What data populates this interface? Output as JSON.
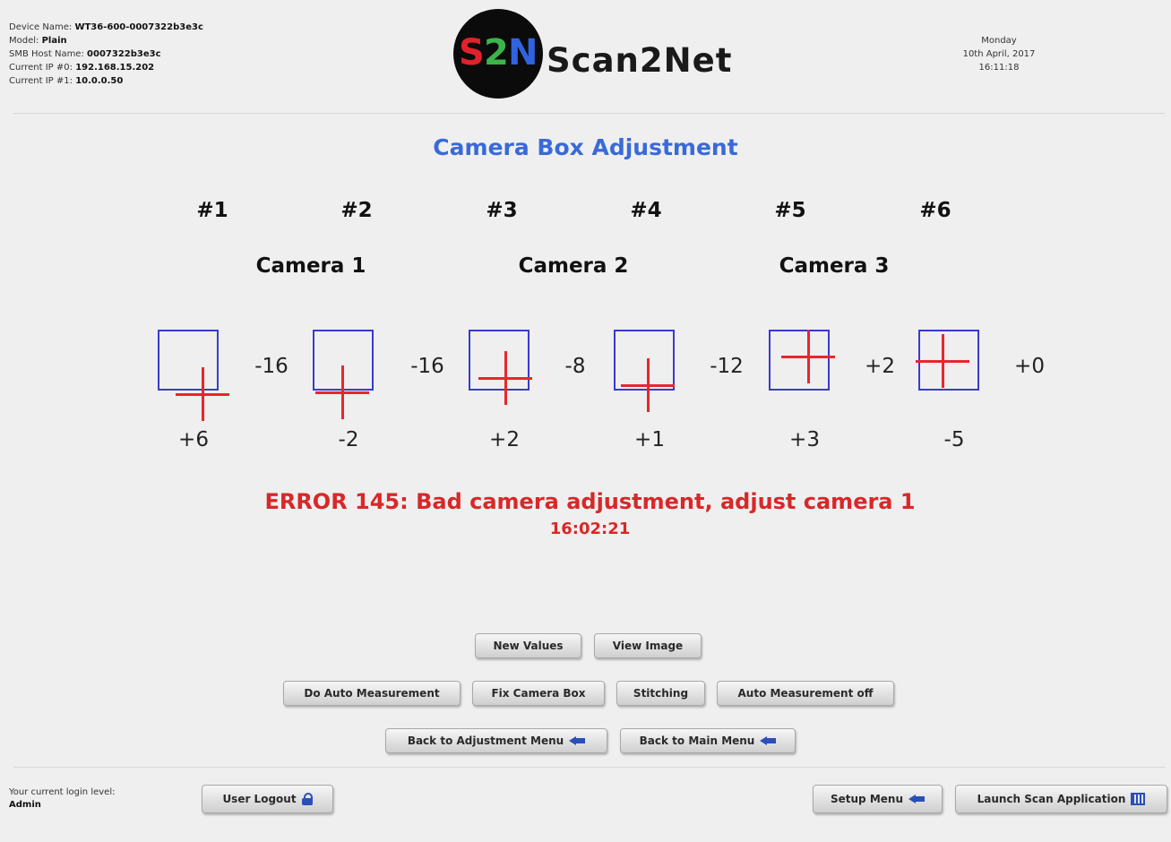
{
  "header": {
    "device_info": [
      {
        "label": "Device Name:",
        "value": "WT36-600-0007322b3e3c"
      },
      {
        "label": "Model:",
        "value": "Plain"
      },
      {
        "label": "SMB Host Name:",
        "value": "0007322b3e3c"
      },
      {
        "label": "Current IP #0:",
        "value": "192.168.15.202"
      },
      {
        "label": "Current IP #1:",
        "value": "10.0.0.50"
      }
    ],
    "logo": {
      "s": "S",
      "two": "2",
      "n": "N",
      "word": "Scan2Net"
    },
    "date": {
      "day": "Monday",
      "date": "10th April, 2017",
      "time": "16:11:18"
    }
  },
  "page_title": "Camera Box Adjustment",
  "numbers": [
    "#1",
    "#2",
    "#3",
    "#4",
    "#5",
    "#6"
  ],
  "cameras": [
    "Camera 1",
    "Camera 2",
    "Camera 3"
  ],
  "adjust_boxes": [
    {
      "horizontal": "-16",
      "vertical": "+6"
    },
    {
      "horizontal": "-16",
      "vertical": "-2"
    },
    {
      "horizontal": "-8",
      "vertical": "+2"
    },
    {
      "horizontal": "-12",
      "vertical": "+1"
    },
    {
      "horizontal": "+2",
      "vertical": "+3"
    },
    {
      "horizontal": "+0",
      "vertical": "-5"
    }
  ],
  "error": {
    "message": "ERROR 145: Bad camera adjustment, adjust camera 1",
    "time": "16:02:21"
  },
  "buttons": {
    "new_values": "New Values",
    "view_image": "View Image",
    "do_auto_measurement": "Do Auto Measurement",
    "fix_camera_box": "Fix Camera Box",
    "stitching": "Stitching",
    "auto_measurement_off": "Auto Measurement off",
    "back_adjustment": "Back to Adjustment Menu",
    "back_main": "Back to Main Menu",
    "user_logout": "User Logout",
    "setup_menu": "Setup Menu",
    "launch_scan": "Launch Scan Application"
  },
  "login": {
    "label": "Your current login level:",
    "level": "Admin"
  },
  "colors": {
    "title": "#3a6ad8",
    "error": "#d82828",
    "box_border": "#3a3ad0",
    "crosshair": "#e8262e",
    "icon": "#2a4fb8"
  },
  "icons": {
    "back_arrow": "left-arrow-icon",
    "lock": "lock-icon",
    "launch": "launch-app-icon"
  }
}
